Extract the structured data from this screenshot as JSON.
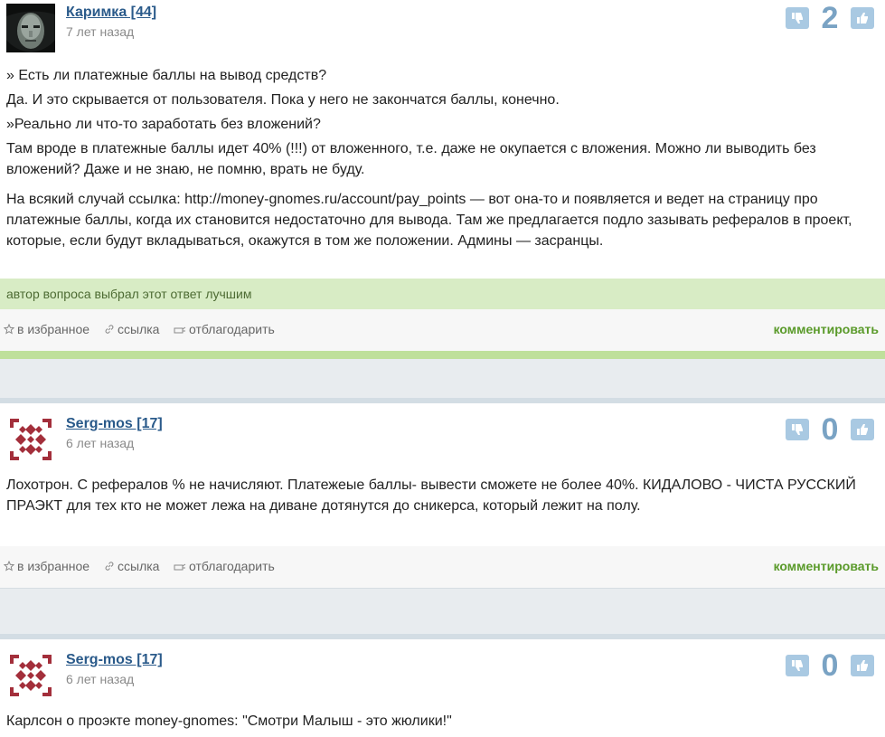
{
  "answers": [
    {
      "user": "Каримка [44]",
      "time": "7 лет назад",
      "score": "2",
      "paragraphs": [
        "» Есть ли платежные баллы на вывод средств?",
        "Да. И это скрывается от пользователя. Пока у него не закончатся баллы, конечно.",
        "»Реально ли что-то заработать без вложений?",
        "Там вроде в платежные баллы идет 40% (!!!) от вложенного, т.е. даже не окупается с вложения. Можно ли выводить без вложений? Даже и не знаю, не помню, врать не буду.",
        "На всякий случай ссылка: http://money-gnomes.ru/account/pay_points — вот она-то и появляется и ведет на страницу про платежные баллы, когда их становится недостаточно для вывода. Там же предлагается подло зазывать рефералов в проект, которые, если будут вкладываться, окажутся в том же положении. Админы — засранцы."
      ],
      "best_label": "автор вопроса выбрал этот ответ лучшим"
    },
    {
      "user": "Serg-mos [17]",
      "time": "6 лет назад",
      "score": "0",
      "paragraphs": [
        "Лохотрон. С рефералов % не начисляют. Платежеые баллы- вывести сможете не более 40%. КИДАЛОВО - ЧИСТА РУССКИЙ ПРАЭКТ для тех кто не может лежа на диване дотянутся до сникерса, который лежит на полу."
      ]
    },
    {
      "user": "Serg-mos [17]",
      "time": "6 лет назад",
      "score": "0",
      "paragraphs": [
        "Карлсон о проэкте money-gnomes: \"Смотри Малыш - это жюлики!\""
      ]
    }
  ],
  "actions": {
    "favorite": "в избранное",
    "link": "ссылка",
    "thank": "отблагодарить",
    "comment": "комментировать"
  },
  "icons": {
    "vote_down": "thumbs-down-icon",
    "vote_up": "thumbs-up-icon",
    "favorite": "star-icon",
    "link": "chain-link-icon",
    "thank": "gift-icon"
  },
  "colors": {
    "username": "#2a5a8a",
    "score": "#7aa3c4",
    "vote_button": "#a9c9e2",
    "best_bar": "#d8ecc5",
    "comment_link": "#5a9a2a",
    "separator": "#e8ecef"
  }
}
